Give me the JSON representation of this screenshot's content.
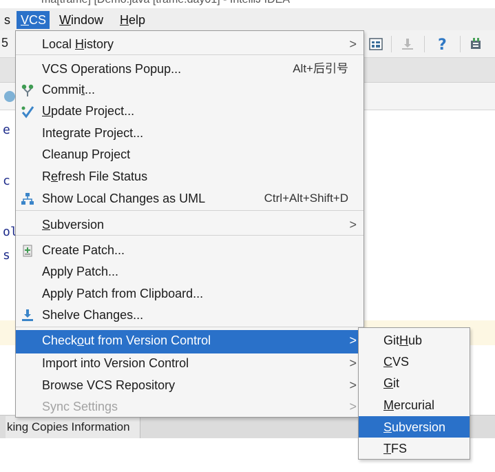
{
  "window": {
    "title_fragment": "ma[trame] [Demo.java [trame.day01] - IntelliJ IDEA"
  },
  "menubar": {
    "left_edge": "s",
    "items": [
      {
        "label": "VCS",
        "mnemonic": "V",
        "rest": "CS",
        "active": true
      },
      {
        "label": "Window",
        "mnemonic": "W",
        "rest": "indow"
      },
      {
        "label": "Help",
        "mnemonic": "H",
        "rest": "elp"
      }
    ]
  },
  "toolbar": {
    "left_edge": "5",
    "icons": [
      "project-structure-icon",
      "download-icon",
      "help-icon",
      "plugin-icon"
    ]
  },
  "editor": {
    "gutter_glyphs": [
      "e",
      "c",
      "ol",
      "s"
    ]
  },
  "bottom_tab": {
    "label": "king Copies Information"
  },
  "vcs_menu": {
    "items": [
      {
        "pre": "Local ",
        "mn": "H",
        "post": "istory",
        "submenu": true
      },
      {
        "pre": "VCS Operations Popup...",
        "mn": "",
        "post": "",
        "shortcut": "Alt+后引号"
      },
      {
        "pre": "Commi",
        "mn": "t",
        "post": "...",
        "icon": "commit-icon"
      },
      {
        "pre": "",
        "mn": "U",
        "post": "pdate Project...",
        "icon": "update-project-icon"
      },
      {
        "pre": "Inte",
        "mn": "g",
        "post": "rate Project..."
      },
      {
        "pre": "Cleanup Project",
        "mn": "",
        "post": ""
      },
      {
        "pre": "R",
        "mn": "e",
        "post": "fresh File Status"
      },
      {
        "pre": "Show Local Changes as UML",
        "mn": "",
        "post": "",
        "shortcut": "Ctrl+Alt+Shift+D",
        "icon": "uml-diagram-icon"
      },
      {
        "pre": "",
        "mn": "S",
        "post": "ubversion",
        "submenu": true
      },
      {
        "pre": "Create Patch...",
        "mn": "",
        "post": "",
        "icon": "create-patch-icon"
      },
      {
        "pre": "Apply Patch...",
        "mn": "",
        "post": ""
      },
      {
        "pre": "Apply Patch from Clipboard...",
        "mn": "",
        "post": ""
      },
      {
        "pre": "Shelve Changes...",
        "mn": "",
        "post": "",
        "icon": "shelve-icon"
      },
      {
        "pre": "Check",
        "mn": "o",
        "post": "ut from Version Control",
        "submenu": true,
        "selected": true
      },
      {
        "pre": "Import into Version Control",
        "mn": "",
        "post": "",
        "submenu": true
      },
      {
        "pre": "Browse VCS Repository",
        "mn": "",
        "post": "",
        "submenu": true
      },
      {
        "pre": "Sync Settings",
        "mn": "",
        "post": "",
        "submenu": true,
        "disabled": true
      }
    ]
  },
  "checkout_submenu": {
    "items": [
      {
        "pre": "Git",
        "mn": "H",
        "post": "ub"
      },
      {
        "pre": "",
        "mn": "C",
        "post": "VS"
      },
      {
        "pre": "",
        "mn": "G",
        "post": "it"
      },
      {
        "pre": "",
        "mn": "M",
        "post": "ercurial"
      },
      {
        "pre": "",
        "mn": "S",
        "post": "ubversion",
        "selected": true
      },
      {
        "pre": "",
        "mn": "T",
        "post": "FS"
      }
    ]
  },
  "colors": {
    "selection": "#2a71c9",
    "menu_bg": "#f5f5f5",
    "disabled_text": "#a3a3a3"
  },
  "arrow_glyph": ">"
}
